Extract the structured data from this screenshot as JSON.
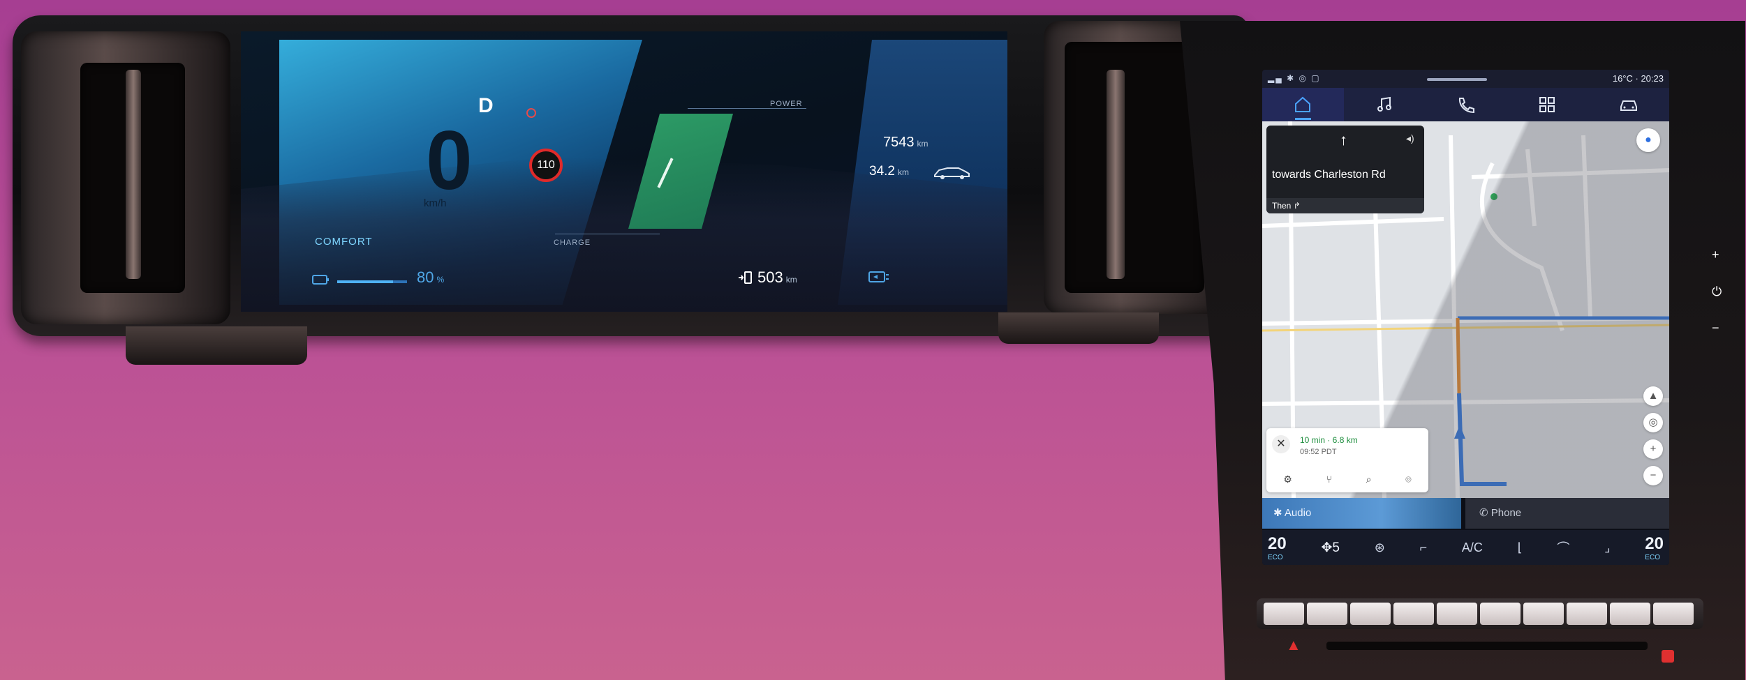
{
  "cluster": {
    "gear": "D",
    "speed": "0",
    "speed_unit": "km/h",
    "speed_limit": "110",
    "drive_mode": "COMFORT",
    "battery_percent": "80",
    "battery_unit": "%",
    "power_label": "POWER",
    "charge_label": "CHARGE",
    "odometer": "7543",
    "odometer_unit": "km",
    "trip": "34.2",
    "trip_unit": "km",
    "range": "503",
    "range_unit": "km"
  },
  "infotainment": {
    "status": {
      "temperature": "16°C",
      "time": "20:23"
    },
    "tabs": [
      {
        "name": "home",
        "icon": "home-icon",
        "active": true
      },
      {
        "name": "music",
        "icon": "music-icon",
        "active": false
      },
      {
        "name": "phone",
        "icon": "phone-icon",
        "active": false
      },
      {
        "name": "apps",
        "icon": "apps-icon",
        "active": false
      },
      {
        "name": "car",
        "icon": "car-icon",
        "active": false
      }
    ],
    "navigation": {
      "street": "towards Charleston Rd",
      "then_label": "Then",
      "eta_time": "10 min · 6.8 km",
      "eta_arrival": "09:52 PDT"
    },
    "media": {
      "audio_label": "Audio",
      "phone_label": "Phone"
    },
    "climate": {
      "left_temp": "20",
      "right_temp": "20",
      "left_mode": "ECO",
      "right_mode": "ECO",
      "fan_speed": "5",
      "ac_label": "A/C"
    }
  },
  "colors": {
    "accent": "#4aa3ff",
    "speed_limit_ring": "#e02a2a",
    "power_panel": "#2fa36a",
    "background": "#b94f96"
  }
}
